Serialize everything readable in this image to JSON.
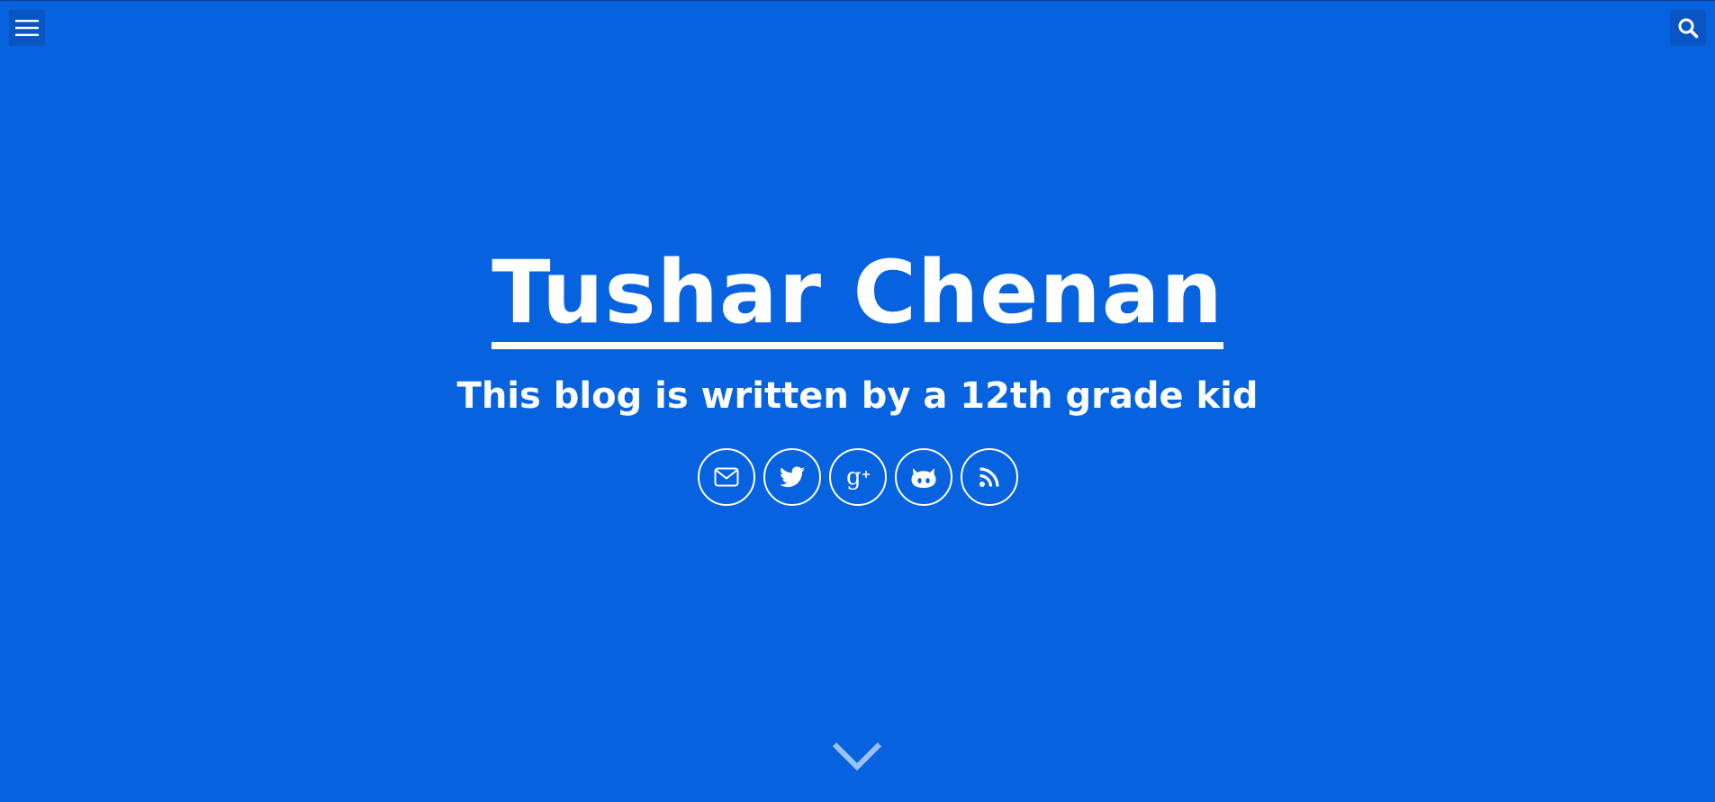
{
  "header": {
    "menu_icon": "hamburger-menu-icon",
    "search_icon": "search-icon"
  },
  "hero": {
    "title": "Tushar Chenan",
    "subtitle": "This blog is written by a 12th grade kid"
  },
  "social": [
    {
      "icon": "email-icon"
    },
    {
      "icon": "twitter-icon"
    },
    {
      "icon": "google-plus-icon"
    },
    {
      "icon": "github-icon"
    },
    {
      "icon": "rss-icon"
    }
  ],
  "scroll": {
    "icon": "chevron-down-icon"
  },
  "colors": {
    "background": "#0662df",
    "button_bg": "#0a55c4",
    "foreground": "#ffffff"
  }
}
